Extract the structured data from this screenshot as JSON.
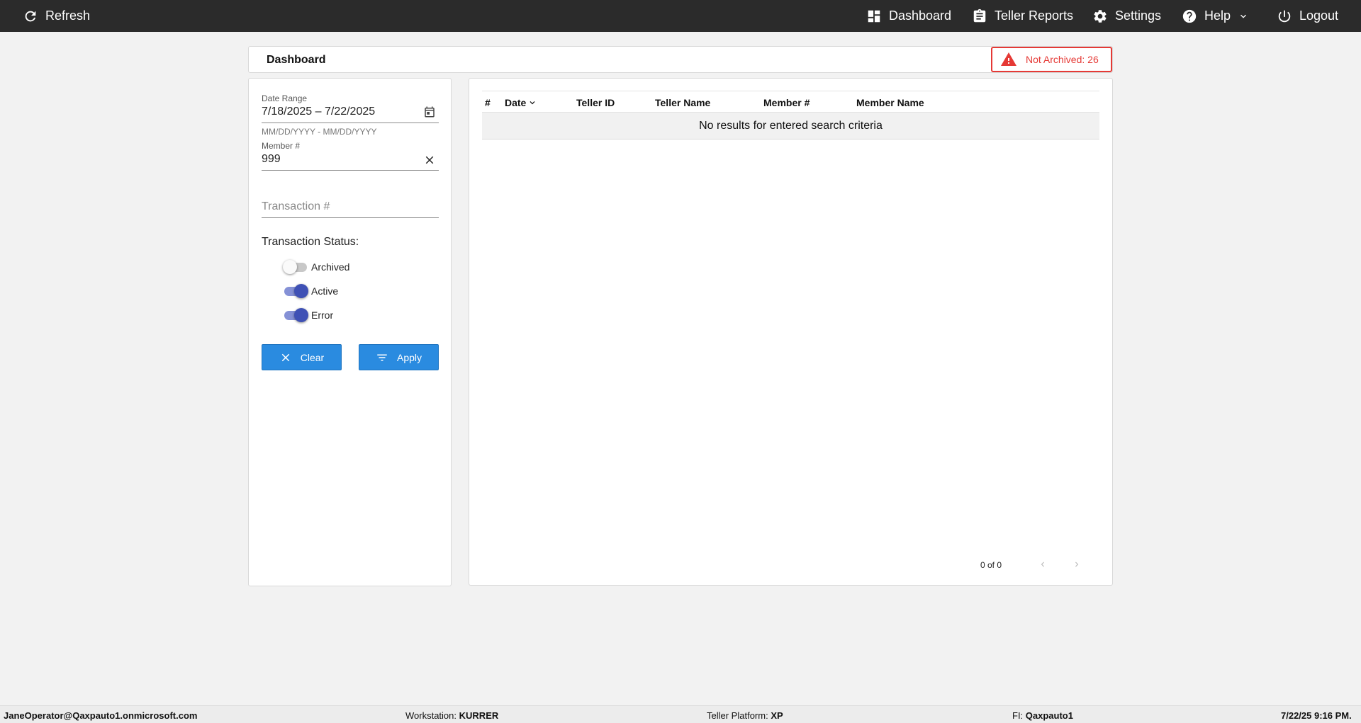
{
  "topbar": {
    "refresh_label": "Refresh",
    "nav": {
      "dashboard": "Dashboard",
      "teller_reports": "Teller Reports",
      "settings": "Settings",
      "help": "Help",
      "logout": "Logout"
    },
    "icons": [
      "refresh-icon",
      "dashboard-icon",
      "clipboard-icon",
      "gear-icon",
      "help-icon",
      "chevron-down-icon",
      "power-icon"
    ]
  },
  "header": {
    "title": "Dashboard",
    "alert": "Not Archived: 26",
    "alert_color": "#e53935"
  },
  "filters": {
    "date_range": {
      "label": "Date Range",
      "value": "7/18/2025 – 7/22/2025",
      "hint": "MM/DD/YYYY - MM/DD/YYYY"
    },
    "member": {
      "label": "Member #",
      "value": "999"
    },
    "transaction": {
      "placeholder": "Transaction #"
    },
    "status_title": "Transaction Status:",
    "statuses": [
      {
        "label": "Archived",
        "on": false
      },
      {
        "label": "Active",
        "on": true
      },
      {
        "label": "Error",
        "on": true
      }
    ],
    "clear_label": "Clear",
    "apply_label": "Apply",
    "button_color": "#2a8be0",
    "toggle_color": "#3f51b5"
  },
  "table": {
    "columns": [
      "#",
      "Date",
      "Teller ID",
      "Teller Name",
      "Member #",
      "Member Name"
    ],
    "empty_message": "No results for entered search criteria",
    "paginator": "0 of 0"
  },
  "statusbar": {
    "user": "JaneOperator@Qaxpauto1.onmicrosoft.com",
    "workstation_label": "Workstation:",
    "workstation": "KURRER",
    "platform_label": "Teller Platform:",
    "platform": "XP",
    "fi_label": "FI:",
    "fi": "Qaxpauto1",
    "datetime": "7/22/25 9:16 PM."
  }
}
